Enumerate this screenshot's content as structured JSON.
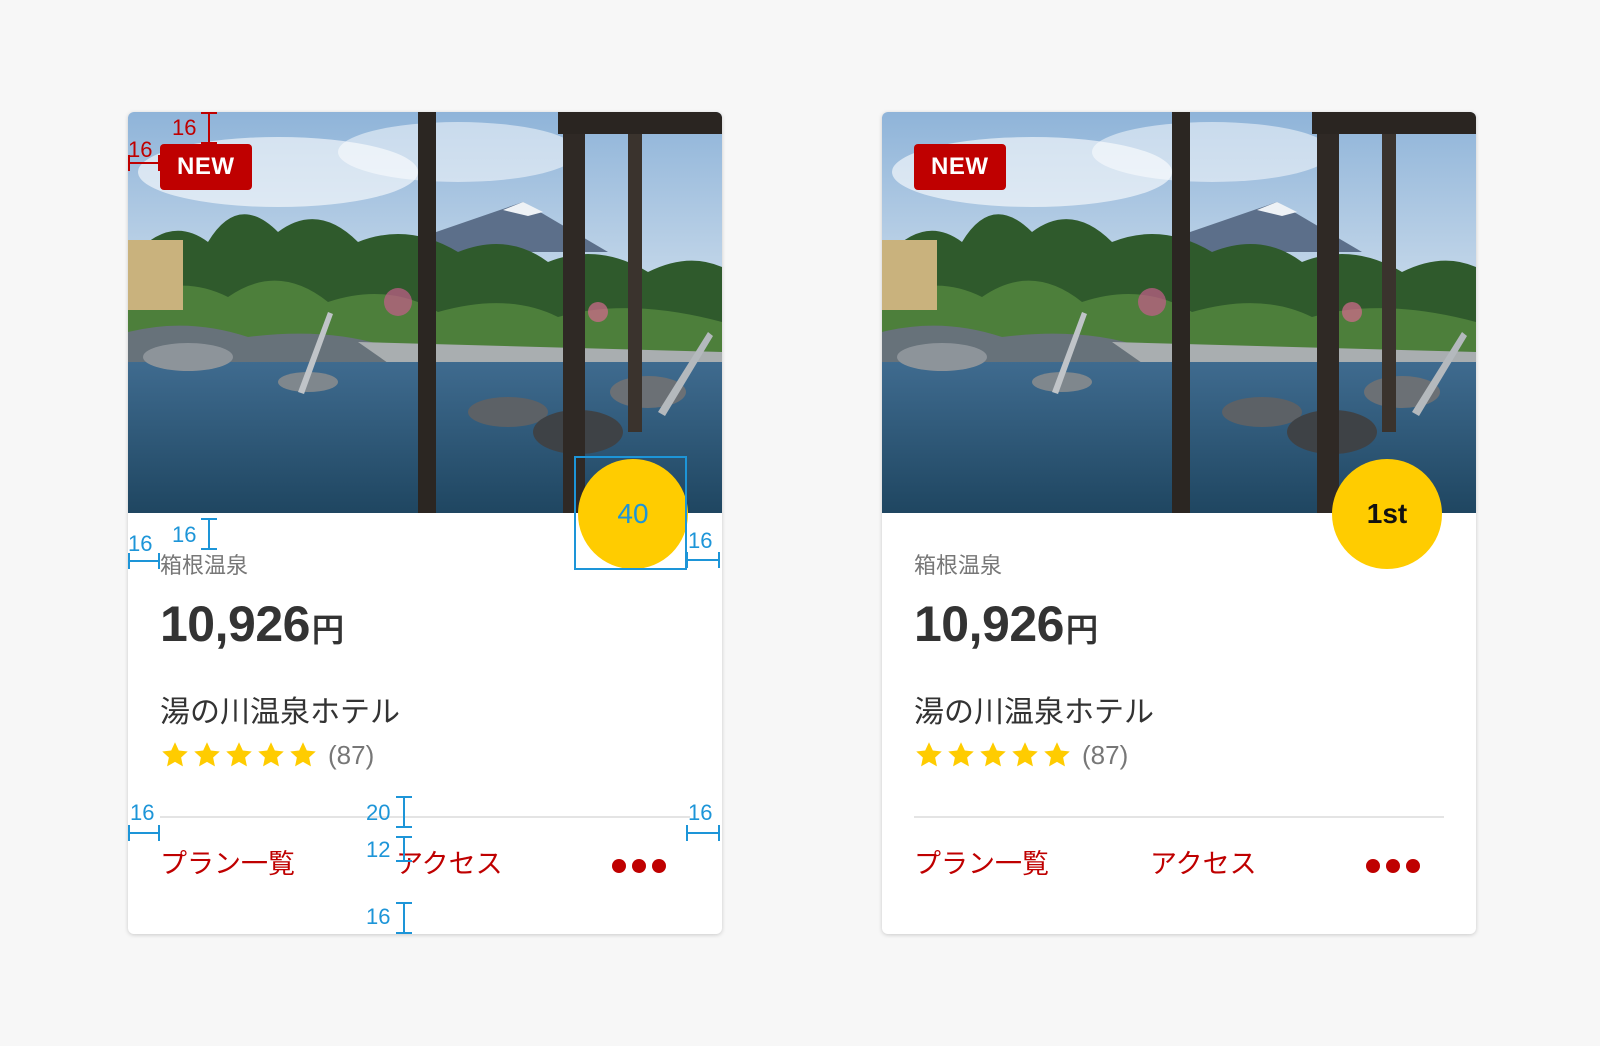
{
  "cards": [
    {
      "badge": "NEW",
      "rank": "40",
      "area": "箱根温泉",
      "price": "10,926",
      "price_unit": "円",
      "name": "湯の川温泉ホテル",
      "rating": 5,
      "review_count": "(87)",
      "links": {
        "plan": "プラン一覧",
        "access": "アクセス"
      }
    },
    {
      "badge": "NEW",
      "rank": "1st",
      "area": "箱根温泉",
      "price": "10,926",
      "price_unit": "円",
      "name": "湯の川温泉ホテル",
      "rating": 5,
      "review_count": "(87)",
      "links": {
        "plan": "プラン一覧",
        "access": "アクセス"
      }
    }
  ],
  "annotations": {
    "badge_top": "16",
    "badge_left": "16",
    "content_left": "16",
    "content_top": "16",
    "rank_right": "16",
    "divider_left": "16",
    "divider_right": "16",
    "divider_top": "20",
    "links_top": "12",
    "links_bottom": "16"
  },
  "colors": {
    "brand_red": "#bf0000",
    "rank_yellow": "#ffcc00",
    "annotation_blue": "#1d95d8",
    "text_dark": "#333333",
    "text_gray": "#777777",
    "star": "#ffcc00"
  },
  "icons": {
    "star": "star-icon",
    "more": "more-dots-icon"
  }
}
